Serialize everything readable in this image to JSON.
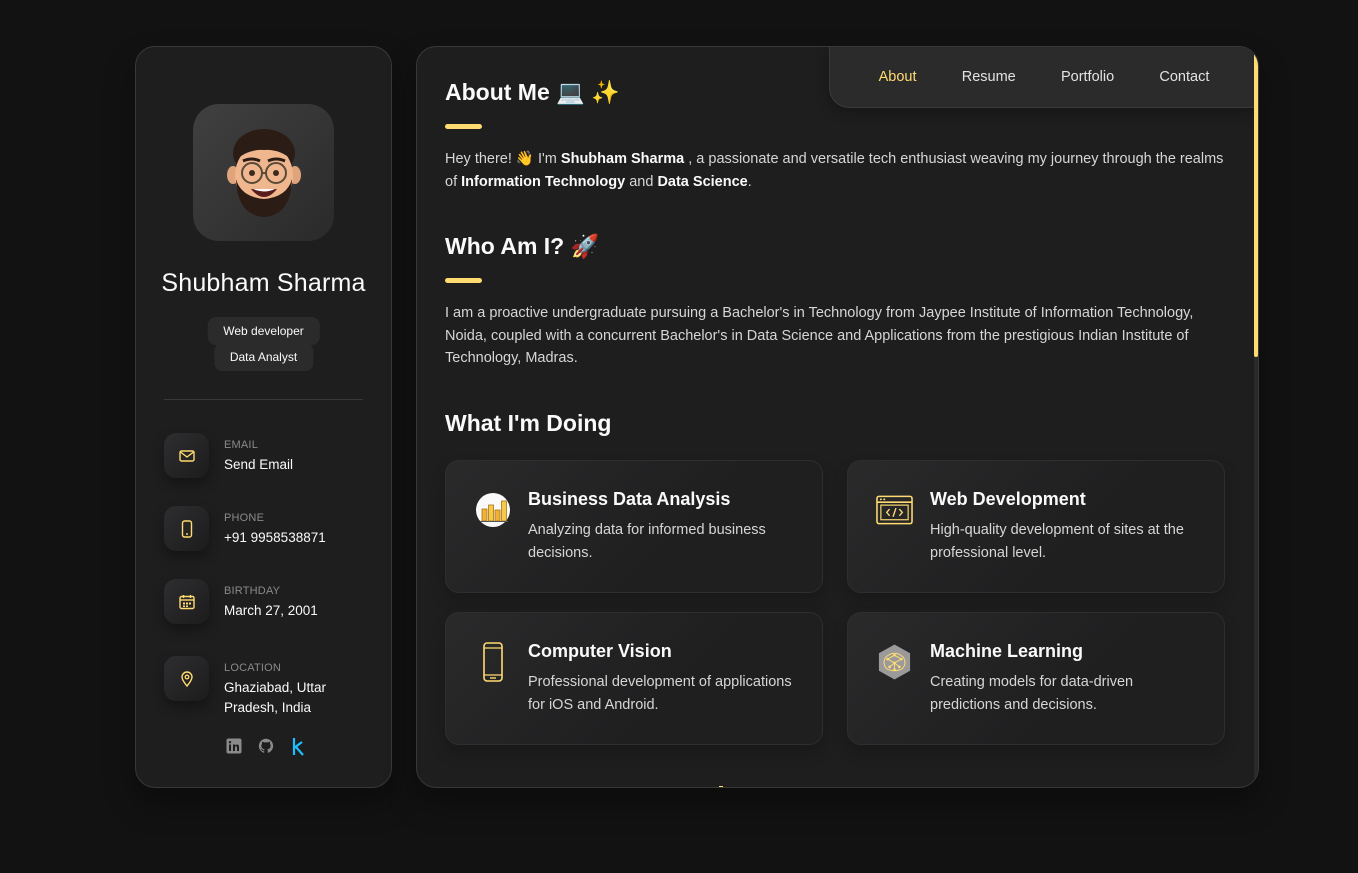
{
  "profile": {
    "name": "Shubham Sharma",
    "titles": [
      "Web developer",
      "Data Analyst"
    ]
  },
  "contacts": [
    {
      "label": "Email",
      "value": "Send Email",
      "icon": "mail-icon"
    },
    {
      "label": "Phone",
      "value": "+91 9958538871",
      "icon": "phone-icon"
    },
    {
      "label": "Birthday",
      "value": "March 27, 2001",
      "icon": "calendar-icon"
    },
    {
      "label": "Location",
      "value": "Ghaziabad, Uttar Pradesh, India",
      "icon": "location-pin-icon"
    }
  ],
  "socials": [
    "linkedin-icon",
    "github-icon",
    "kaggle-icon"
  ],
  "nav": [
    "About",
    "Resume",
    "Portfolio",
    "Contact"
  ],
  "active_nav": "About",
  "about": {
    "heading": "About Me 💻 ✨",
    "intro_pre": "Hey there!  👋 I'm ",
    "intro_name": "Shubham Sharma",
    "intro_mid": " , a passionate and versatile tech enthusiast weaving my journey through the realms of ",
    "intro_it": "Information Technology",
    "intro_and": " and ",
    "intro_ds": "Data Science",
    "intro_end": "."
  },
  "who": {
    "heading": "Who Am I? 🚀",
    "text": "I am a proactive undergraduate pursuing a Bachelor's in Technology from Jaypee Institute of Information Technology, Noida, coupled with a concurrent Bachelor's in Data Science and Applications from the prestigious Indian Institute of Technology, Madras."
  },
  "doing": {
    "heading": "What I'm Doing",
    "services": [
      {
        "title": "Business Data Analysis",
        "desc": "Analyzing data for informed business decisions.",
        "icon": "bar-chart-icon"
      },
      {
        "title": "Web Development",
        "desc": "High-quality development of sites at the professional level.",
        "icon": "code-window-icon"
      },
      {
        "title": "Computer Vision",
        "desc": "Professional development of applications for iOS and Android.",
        "icon": "mobile-phone-icon"
      },
      {
        "title": "Machine Learning",
        "desc": "Creating models for data-driven predictions and decisions.",
        "icon": "neural-network-icon"
      }
    ]
  },
  "colors": {
    "accent": "#ffdb70",
    "background": "#121212",
    "panel": "#1e1e1f"
  }
}
